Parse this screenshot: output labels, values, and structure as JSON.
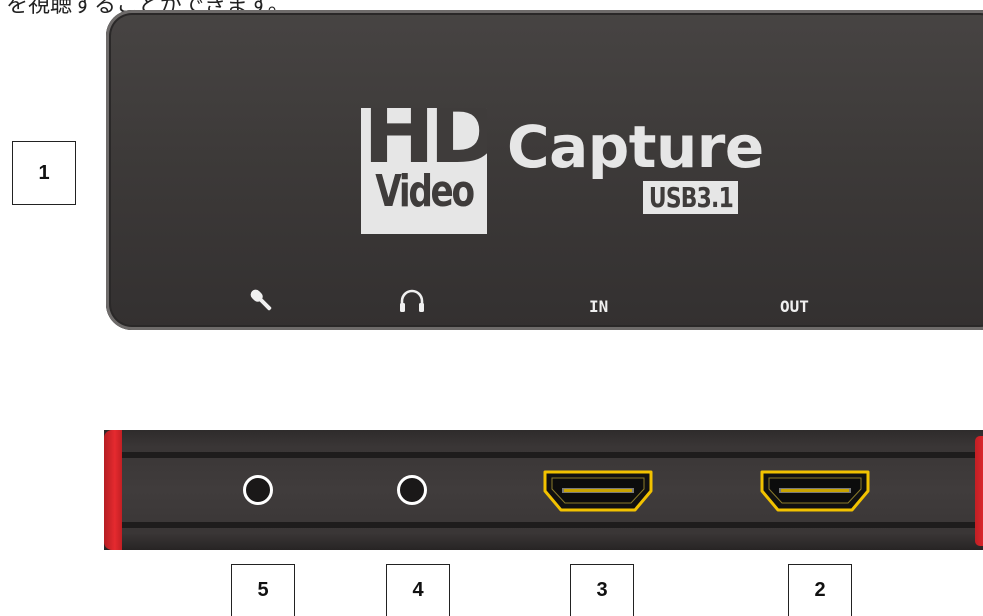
{
  "caption": "を視聴することができます。",
  "device": {
    "logo_hd": "HD",
    "logo_video": "Video",
    "logo_capture": "Capture",
    "logo_usb": "USB3.1",
    "port_in_label": "IN",
    "port_out_label": "OUT",
    "icons": [
      "microphone-icon",
      "headphones-icon"
    ],
    "side_ports": [
      "mic-jack",
      "headphone-jack",
      "hdmi-in-port",
      "hdmi-out-port"
    ]
  },
  "callouts": {
    "c1": "1",
    "c2": "2",
    "c3": "3",
    "c4": "4",
    "c5": "5"
  },
  "colors": {
    "body": "#3d3a39",
    "accent_red": "#e52a2f",
    "hdmi_gold": "#f2c200",
    "logo_light": "#e6e6e6"
  }
}
